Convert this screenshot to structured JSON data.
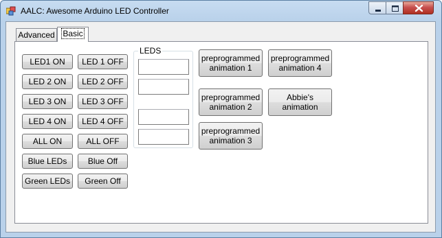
{
  "window": {
    "title": "AALC:  Awesome Arduino LED Controller",
    "accent": "#b9d1ea"
  },
  "tabs": [
    {
      "label": "Advanced",
      "selected": false
    },
    {
      "label": "Basic",
      "selected": true
    }
  ],
  "buttons": {
    "led1_on": "LED1 ON",
    "led1_off": "LED 1 OFF",
    "led2_on": "LED 2 ON",
    "led2_off": "LED 2 OFF",
    "led3_on": "LED 3 ON",
    "led3_off": "LED 3 OFF",
    "led4_on": "LED 4 ON",
    "led4_off": "LED 4 OFF",
    "all_on": "ALL ON",
    "all_off": "ALL OFF",
    "blue_leds": "Blue LEDs",
    "blue_off": "Blue Off",
    "green_leds": "Green LEDs",
    "green_off": "Green Off"
  },
  "leds_group": {
    "legend": "LEDS",
    "fields": [
      "",
      "",
      "",
      ""
    ]
  },
  "animations": {
    "anim1": "preprogrammed animation 1",
    "anim2": "preprogrammed animation 2",
    "anim3": "preprogrammed animation 3",
    "anim4": "preprogrammed animation 4",
    "abbie": "Abbie's animation"
  }
}
